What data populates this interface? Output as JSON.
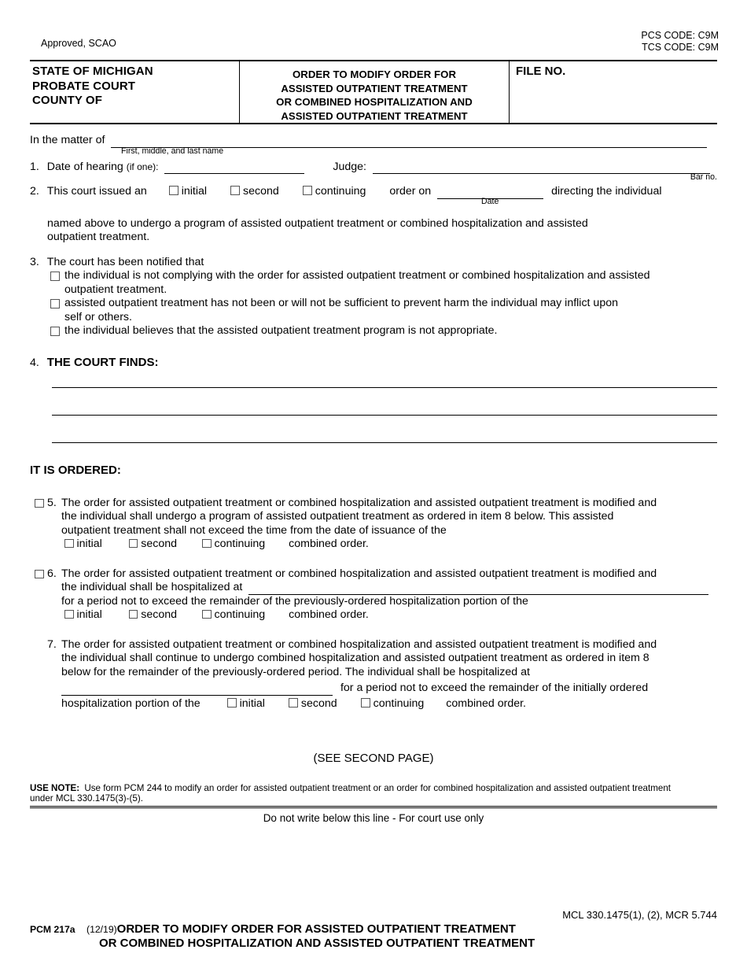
{
  "top": {
    "pcs_code": "PCS CODE: C9M",
    "tcs_code": "TCS CODE: C9M",
    "approved": "Approved, SCAO"
  },
  "header": {
    "state_line1": "STATE OF MICHIGAN",
    "state_line2": "PROBATE COURT",
    "state_line3": "COUNTY OF",
    "title_line1": "ORDER TO MODIFY ORDER FOR",
    "title_line2": "ASSISTED OUTPATIENT TREATMENT",
    "title_line3": "OR COMBINED HOSPITALIZATION AND",
    "title_line4": "ASSISTED OUTPATIENT TREATMENT",
    "file_no": "FILE NO."
  },
  "matter": {
    "label": "In the matter of",
    "caption": "First, middle, and last name"
  },
  "item1": {
    "number": "1.",
    "label": "Date of hearing",
    "if_one": "(if one):",
    "judge_label": "Judge:",
    "bar_no": "Bar no."
  },
  "item2": {
    "number": "2.",
    "lead": "This court issued an",
    "opt_initial": "initial",
    "opt_second": "second",
    "opt_continuing": "continuing",
    "order_on": "order on",
    "date_caption": "Date",
    "trailing": "directing the individual",
    "cont_line1": "named above to undergo a program of assisted outpatient treatment or combined hospitalization and assisted",
    "cont_line2": "outpatient treatment."
  },
  "item3": {
    "number": "3.",
    "lead": "The court has been notified that",
    "options": [
      {
        "line1": "the individual is not complying with the order for assisted outpatient treatment or combined hospitalization and assisted",
        "line2": "outpatient treatment."
      },
      {
        "line1": "assisted outpatient treatment has not been or will not be sufficient to prevent harm the individual may inflict upon",
        "line2": "self or others."
      },
      {
        "line1": "the individual believes that the assisted outpatient treatment program is not appropriate.",
        "line2": ""
      }
    ]
  },
  "item4": {
    "number": "4.",
    "heading": "THE COURT FINDS:",
    "blank_lines": 3
  },
  "ordered_heading": "IT IS ORDERED:",
  "item5": {
    "number": "5.",
    "line1": "The order for assisted outpatient treatment or combined hospitalization and assisted outpatient treatment is modified and",
    "line2": "the individual shall undergo a program of assisted outpatient treatment as ordered in item 8 below. This assisted",
    "line3": "outpatient treatment shall not exceed the time from the date of issuance of the",
    "opt_initial": "initial",
    "opt_second": "second",
    "opt_continuing": "continuing",
    "combined": "combined order."
  },
  "item6": {
    "number": "6.",
    "line1": "The order for assisted outpatient treatment or combined hospitalization and assisted outpatient treatment is modified and",
    "line2_pre": "the individual shall be hospitalized at",
    "line3": "for a period not to exceed the remainder of the previously-ordered hospitalization portion of the",
    "opt_initial": "initial",
    "opt_second": "second",
    "opt_continuing": "continuing",
    "combined": "combined order."
  },
  "item7": {
    "number": "7.",
    "line1": "The order for assisted outpatient treatment or combined hospitalization and assisted outpatient treatment is modified and",
    "line2": "the individual shall continue to undergo combined hospitalization and assisted outpatient treatment as ordered in item 8",
    "line3": "below for the remainder of the previously-ordered period.  The individual shall be hospitalized at",
    "line4_post": "for a period not to exceed the remainder of the initially ordered",
    "line5_pre": "hospitalization portion of the",
    "opt_initial": "initial",
    "opt_second": "second",
    "opt_continuing": "continuing",
    "combined": "combined order."
  },
  "see_second_page": "(SEE SECOND PAGE)",
  "use_note": {
    "label": "USE NOTE:",
    "line1": "Use form PCM 244 to modify an order for assisted outpatient treatment or an order for combined hospitalization and assisted outpatient treatment",
    "line2": "under MCL 330.1475(3)-(5)."
  },
  "do_not_write": "Do not write below this line - For court use only",
  "footer": {
    "form_code": "PCM 217a",
    "revision": "(12/19)",
    "title_line1": "ORDER TO MODIFY ORDER FOR ASSISTED OUTPATIENT TREATMENT",
    "title_line2": "OR COMBINED HOSPITALIZATION AND ASSISTED OUTPATIENT TREATMENT",
    "citation": "MCL 330.1475(1), (2), MCR 5.744"
  }
}
